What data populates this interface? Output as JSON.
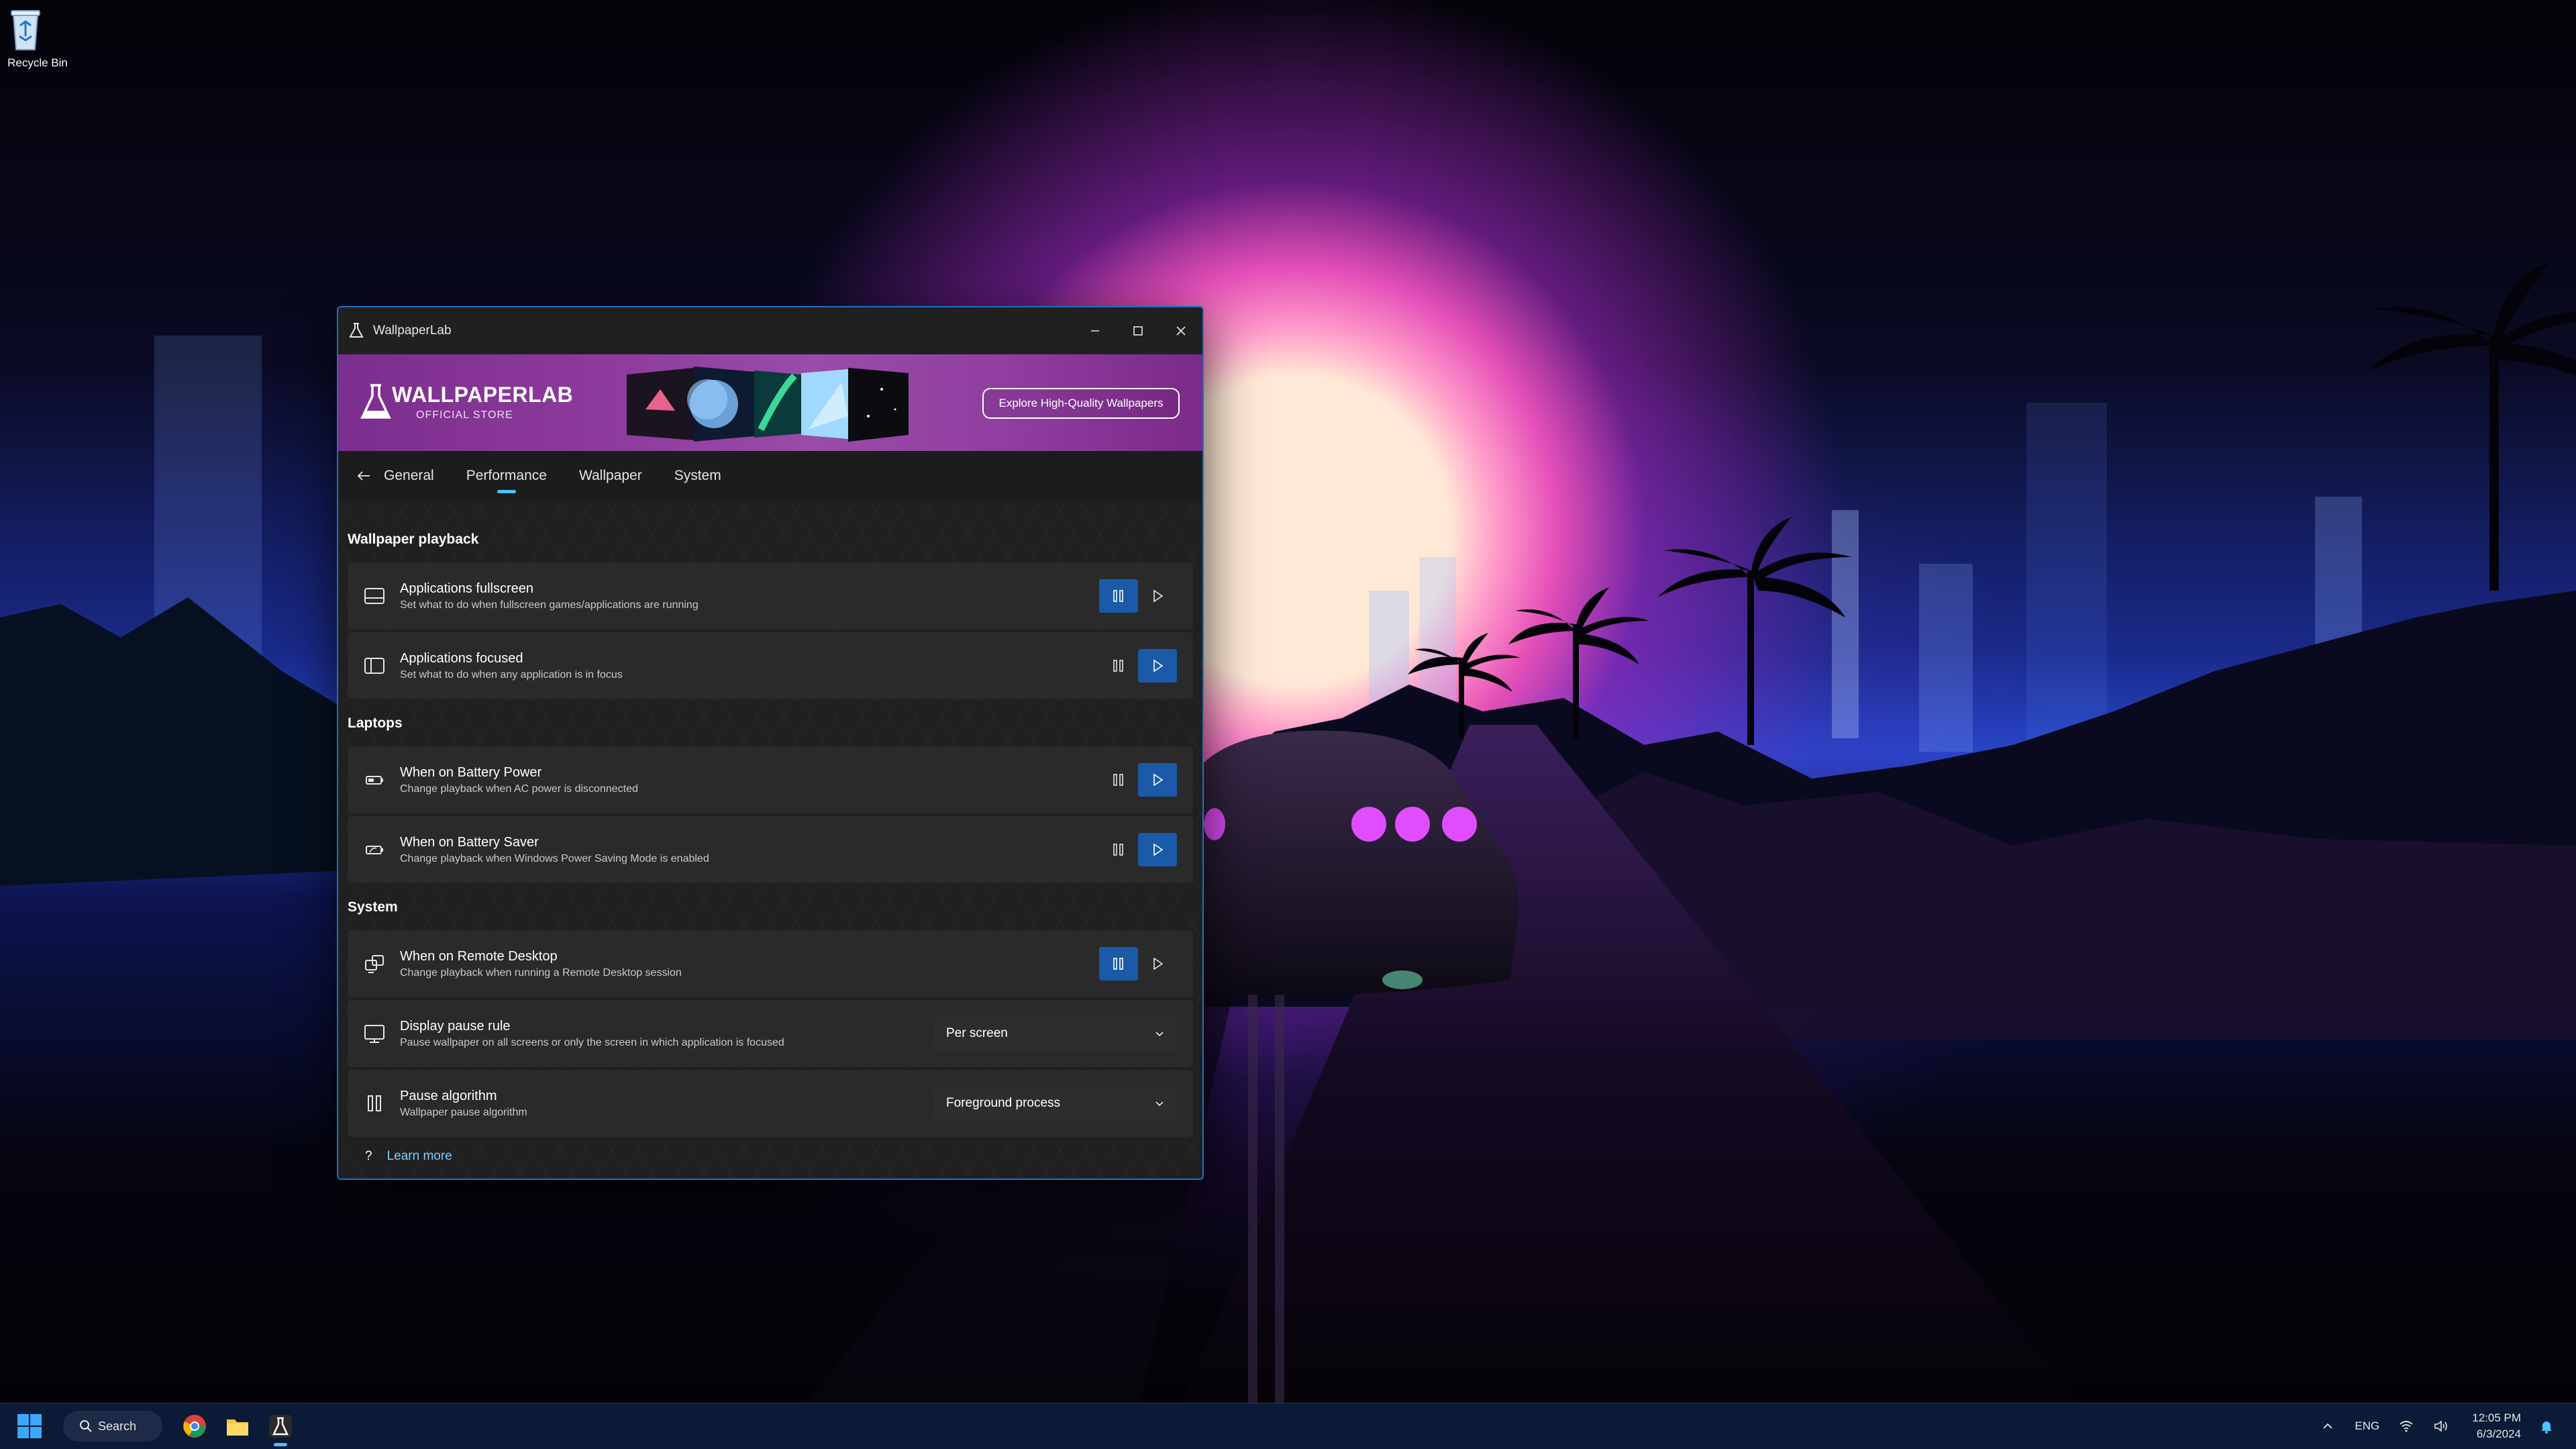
{
  "desktop": {
    "icons": [
      {
        "label": "Recycle Bin",
        "icon": "recycle-bin-icon"
      }
    ]
  },
  "window": {
    "title": "WallpaperLab",
    "banner": {
      "brand": "WALLPAPERLAB",
      "subtitle": "OFFICIAL STORE",
      "cta": "Explore High-Quality Wallpapers"
    },
    "tabs": [
      {
        "label": "General"
      },
      {
        "label": "Performance",
        "active": true
      },
      {
        "label": "Wallpaper"
      },
      {
        "label": "System"
      }
    ],
    "sections": {
      "playback": {
        "title": "Wallpaper playback",
        "rows": [
          {
            "title": "Applications fullscreen",
            "desc": "Set what to do when fullscreen games/applications are running",
            "selected": "pause"
          },
          {
            "title": "Applications focused",
            "desc": "Set what to do when any application is in focus",
            "selected": "play"
          }
        ]
      },
      "laptops": {
        "title": "Laptops",
        "rows": [
          {
            "title": "When on Battery Power",
            "desc": "Change playback when AC power is disconnected",
            "selected": "play"
          },
          {
            "title": "When on Battery Saver",
            "desc": "Change playback when Windows Power Saving Mode is enabled",
            "selected": "play"
          }
        ]
      },
      "system": {
        "title": "System",
        "rows": [
          {
            "title": "When on Remote Desktop",
            "desc": "Change playback when running a Remote Desktop session",
            "selected": "pause"
          },
          {
            "title": "Display pause rule",
            "desc": "Pause wallpaper on all screens or only the screen in which application is focused",
            "value": "Per screen"
          },
          {
            "title": "Pause algorithm",
            "desc": "Wallpaper pause algorithm",
            "value": "Foreground process"
          }
        ]
      }
    },
    "footer": {
      "help_glyph": "?",
      "learn_more": "Learn more"
    }
  },
  "taskbar": {
    "search_label": "Search",
    "apps": [
      {
        "name": "chrome-icon"
      },
      {
        "name": "file-explorer-icon"
      },
      {
        "name": "wallpaperlab-icon",
        "active": true
      }
    ],
    "tray": {
      "language": "ENG",
      "time": "12:05 PM",
      "date": "6/3/2024"
    }
  },
  "colors": {
    "accent": "#4cc2ff",
    "selected_button": "#1a5aa8",
    "window_border": "#1f6fc5",
    "banner": "#8c3a9c"
  }
}
